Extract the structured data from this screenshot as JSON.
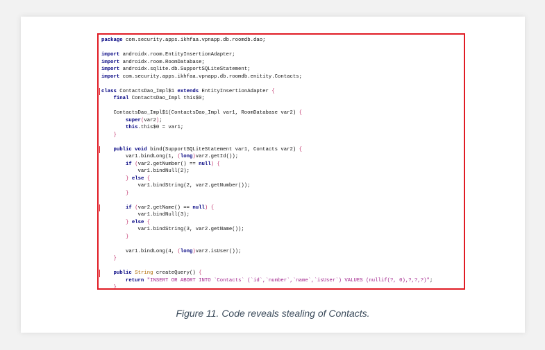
{
  "figure": {
    "caption": "Figure 11. Code reveals stealing of Contacts.",
    "highlight_color": "#e01b24"
  },
  "code_lines": [
    {
      "parts": [
        [
          "kw",
          "package"
        ],
        [
          "t",
          " com.security.apps.ikhfaa.vpnapp.db.roomdb.dao;"
        ]
      ]
    },
    {
      "parts": []
    },
    {
      "parts": [
        [
          "kw",
          "import"
        ],
        [
          "t",
          " androidx.room.EntityInsertionAdapter;"
        ]
      ]
    },
    {
      "parts": [
        [
          "kw",
          "import"
        ],
        [
          "t",
          " androidx.room.RoomDatabase;"
        ]
      ]
    },
    {
      "parts": [
        [
          "kw",
          "import"
        ],
        [
          "t",
          " androidx.sqlite.db.SupportSQLiteStatement;"
        ]
      ]
    },
    {
      "parts": [
        [
          "kw",
          "import"
        ],
        [
          "t",
          " com.security.apps.ikhfaa.vpnapp.db.roomdb.enitity.Contacts;"
        ]
      ]
    },
    {
      "parts": []
    },
    {
      "bar": true,
      "parts": [
        [
          "kw",
          "class"
        ],
        [
          "t",
          " ContactsDao_Impl$1 "
        ],
        [
          "kw",
          "extends"
        ],
        [
          "t",
          " EntityInsertionAdapter "
        ],
        [
          "br",
          "{"
        ]
      ]
    },
    {
      "parts": [
        [
          "t",
          "    "
        ],
        [
          "kw",
          "final"
        ],
        [
          "t",
          " ContactsDao_Impl this$0;"
        ]
      ]
    },
    {
      "parts": []
    },
    {
      "parts": [
        [
          "t",
          "    ContactsDao_Impl$1(ContactsDao_Impl var1, RoomDatabase var2) "
        ],
        [
          "br",
          "{"
        ]
      ]
    },
    {
      "parts": [
        [
          "t",
          "        "
        ],
        [
          "kw",
          "super"
        ],
        [
          "br",
          "("
        ],
        [
          "t",
          "var2"
        ],
        [
          "br",
          ")"
        ],
        [
          "t",
          ";"
        ]
      ]
    },
    {
      "parts": [
        [
          "t",
          "        "
        ],
        [
          "kw",
          "this"
        ],
        [
          "t",
          ".this$0 = var1;"
        ]
      ]
    },
    {
      "parts": [
        [
          "t",
          "    "
        ],
        [
          "br",
          "}"
        ]
      ]
    },
    {
      "parts": []
    },
    {
      "bar": true,
      "parts": [
        [
          "t",
          "    "
        ],
        [
          "kw",
          "public void"
        ],
        [
          "t",
          " bind(SupportSQLiteStatement var1, Contacts var2) "
        ],
        [
          "br",
          "{"
        ]
      ]
    },
    {
      "parts": [
        [
          "t",
          "        var1.bindLong(1, "
        ],
        [
          "br",
          "("
        ],
        [
          "kw",
          "long"
        ],
        [
          "br",
          ")"
        ],
        [
          "t",
          "var2.getId());"
        ]
      ]
    },
    {
      "parts": [
        [
          "t",
          "        "
        ],
        [
          "kw",
          "if"
        ],
        [
          "t",
          " "
        ],
        [
          "br",
          "("
        ],
        [
          "t",
          "var2.getNumber() == "
        ],
        [
          "kw",
          "null"
        ],
        [
          "br",
          ")"
        ],
        [
          "t",
          " "
        ],
        [
          "br",
          "{"
        ]
      ]
    },
    {
      "parts": [
        [
          "t",
          "            var1.bindNull(2);"
        ]
      ]
    },
    {
      "parts": [
        [
          "t",
          "        "
        ],
        [
          "br",
          "}"
        ],
        [
          "t",
          " "
        ],
        [
          "kw",
          "else"
        ],
        [
          "t",
          " "
        ],
        [
          "br",
          "{"
        ]
      ]
    },
    {
      "parts": [
        [
          "t",
          "            var1.bindString(2, var2.getNumber());"
        ]
      ]
    },
    {
      "parts": [
        [
          "t",
          "        "
        ],
        [
          "br",
          "}"
        ]
      ]
    },
    {
      "parts": []
    },
    {
      "bar": true,
      "parts": [
        [
          "t",
          "        "
        ],
        [
          "kw",
          "if"
        ],
        [
          "t",
          " "
        ],
        [
          "br",
          "("
        ],
        [
          "t",
          "var2.getName() == "
        ],
        [
          "kw",
          "null"
        ],
        [
          "br",
          ")"
        ],
        [
          "t",
          " "
        ],
        [
          "br",
          "{"
        ]
      ]
    },
    {
      "parts": [
        [
          "t",
          "            var1.bindNull(3);"
        ]
      ]
    },
    {
      "parts": [
        [
          "t",
          "        "
        ],
        [
          "br",
          "}"
        ],
        [
          "t",
          " "
        ],
        [
          "kw",
          "else"
        ],
        [
          "t",
          " "
        ],
        [
          "br",
          "{"
        ]
      ]
    },
    {
      "parts": [
        [
          "t",
          "            var1.bindString(3, var2.getName());"
        ]
      ]
    },
    {
      "parts": [
        [
          "t",
          "        "
        ],
        [
          "br",
          "}"
        ]
      ]
    },
    {
      "parts": []
    },
    {
      "parts": [
        [
          "t",
          "        var1.bindLong(4, "
        ],
        [
          "br",
          "("
        ],
        [
          "kw",
          "long"
        ],
        [
          "br",
          ")"
        ],
        [
          "t",
          "var2.isUser());"
        ]
      ]
    },
    {
      "parts": [
        [
          "t",
          "    "
        ],
        [
          "br",
          "}"
        ]
      ]
    },
    {
      "parts": []
    },
    {
      "bar": true,
      "parts": [
        [
          "t",
          "    "
        ],
        [
          "kw",
          "public"
        ],
        [
          "t",
          " "
        ],
        [
          "ty",
          "String"
        ],
        [
          "t",
          " createQuery() "
        ],
        [
          "br",
          "{"
        ]
      ]
    },
    {
      "parts": [
        [
          "t",
          "        "
        ],
        [
          "kw",
          "return"
        ],
        [
          "t",
          " "
        ],
        [
          "str",
          "\"INSERT OR ABORT INTO `Contacts` (`id`,`number`,`name`,`isUser`) VALUES (nullif(?, 0),?,?,?)\""
        ],
        [
          "t",
          ";"
        ]
      ]
    },
    {
      "parts": [
        [
          "t",
          "    "
        ],
        [
          "br",
          "}"
        ]
      ]
    }
  ]
}
